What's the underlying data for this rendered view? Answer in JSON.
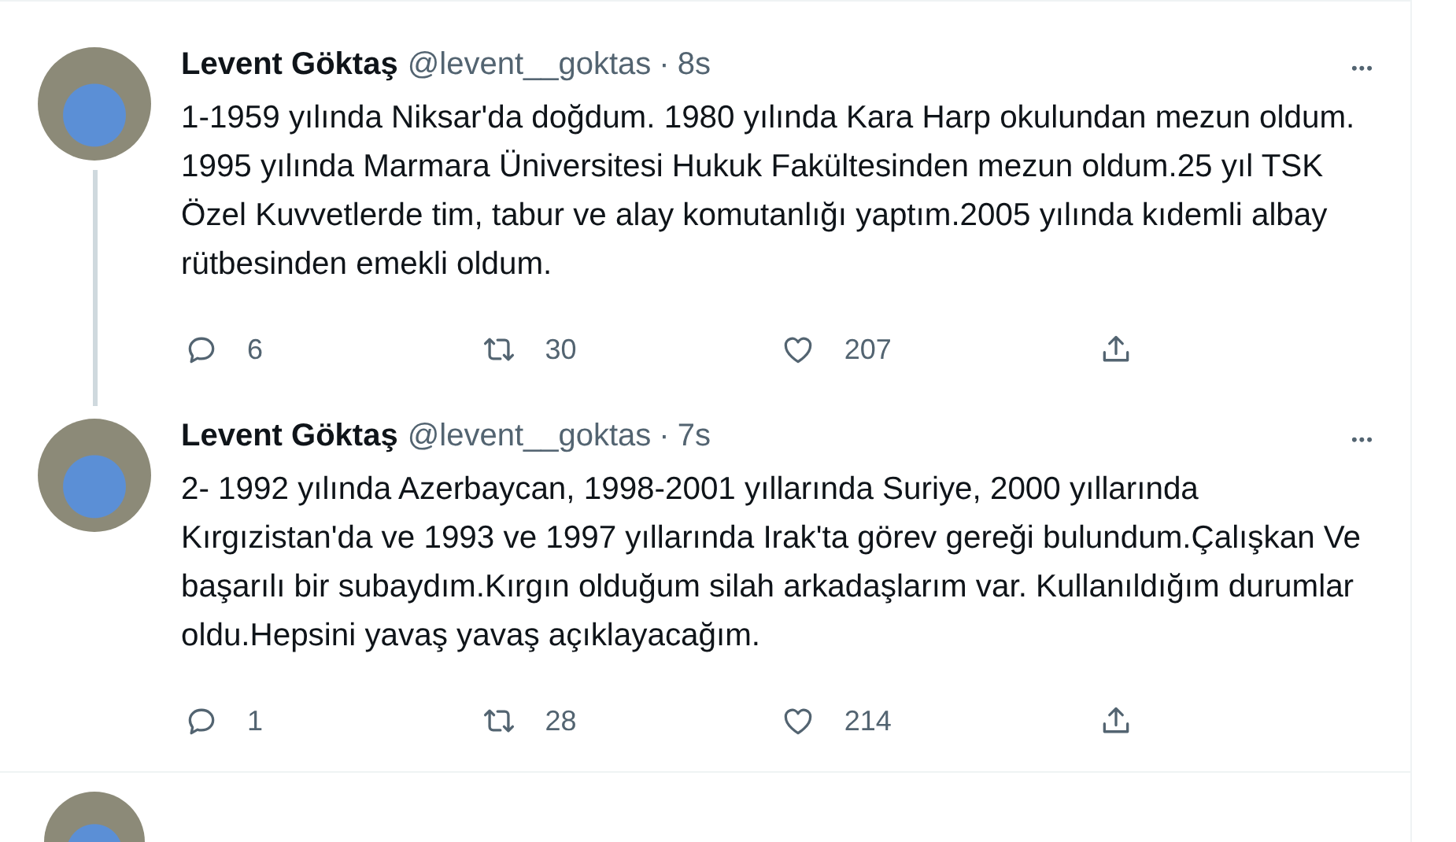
{
  "tweets": [
    {
      "name": "Levent Göktaş",
      "handle": "@levent__goktas",
      "dot": "·",
      "time": "8s",
      "more": "•••",
      "text": "1-1959 yılında Niksar'da doğdum. 1980 yılında Kara Harp okulundan mezun oldum. 1995 yılında Marmara Üniversitesi Hukuk Fakültesinden mezun oldum.25 yıl TSK Özel Kuvvetlerde tim, tabur ve alay komutanlığı yaptım.2005 yılında kıdemli albay rütbesinden emekli oldum.",
      "thread_line": true,
      "replies": "6",
      "retweets": "30",
      "likes": "207"
    },
    {
      "name": "Levent Göktaş",
      "handle": "@levent__goktas",
      "dot": "·",
      "time": "7s",
      "more": "•••",
      "text": "2- 1992 yılında Azerbaycan, 1998-2001 yıllarında Suriye, 2000 yıllarında Kırgızistan'da ve 1993 ve 1997 yıllarında Irak'ta görev gereği bulundum.Çalışkan Ve başarılı bir subaydım.Kırgın olduğum silah arkadaşlarım var. Kullanıldığım durumlar oldu.Hepsini yavaş yavaş açıklayacağım.",
      "thread_line": false,
      "replies": "1",
      "retweets": "28",
      "likes": "214"
    }
  ]
}
